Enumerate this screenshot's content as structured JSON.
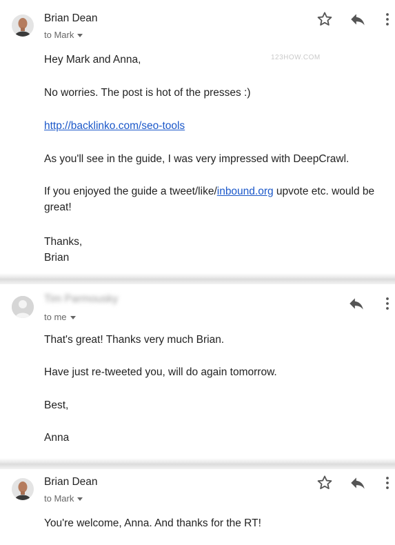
{
  "watermark": "123HOW.COM",
  "messages": [
    {
      "sender": "Brian Dean",
      "recipient": "to Mark",
      "lines": [
        "Hey Mark and Anna,",
        "No worries. The post is hot of the presses :)",
        "http://backlinko.com/seo-tools",
        "As you'll see in the guide, I was very impressed with DeepCrawl.",
        "If you enjoyed the guide a tweet/like/",
        "inbound.org",
        " upvote etc. would be",
        "great!",
        "Thanks,",
        "Brian"
      ]
    },
    {
      "sender": "Tim Parmousky",
      "recipient": "to me",
      "lines": [
        "That's great! Thanks very much Brian.",
        "Have just re-tweeted you, will do again tomorrow.",
        "Best,",
        "Anna"
      ]
    },
    {
      "sender": "Brian Dean",
      "recipient": "to Mark",
      "lines": [
        "You're welcome, Anna. And thanks for the RT!"
      ]
    }
  ],
  "icons": {
    "star": "star-icon",
    "reply": "reply-icon",
    "more": "more-vert-icon",
    "caret": "chevron-down-icon"
  }
}
